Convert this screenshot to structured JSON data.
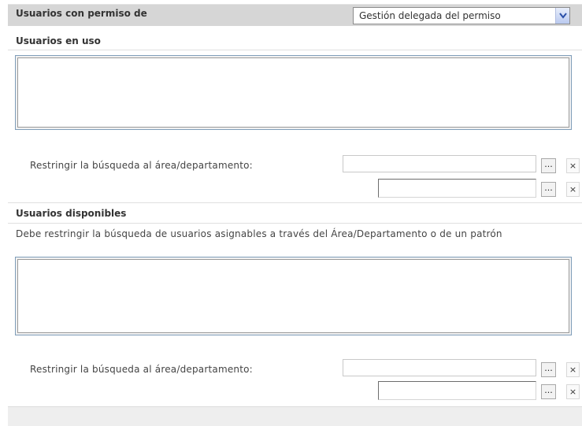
{
  "header": {
    "title": "Usuarios con permiso de",
    "permission_select": {
      "value": "Gestión delegada del permiso",
      "arrow_icon": "chevron-down-icon"
    }
  },
  "in_use": {
    "title": "Usuarios en uso",
    "restrict_label": "Restringir la búsqueda al área/departamento:",
    "browse_label": "...",
    "clear_label": "×"
  },
  "available": {
    "title": "Usuarios disponibles",
    "note": "Debe restringir la búsqueda de usuarios asignables a través del Área/Departamento o de un patrón",
    "restrict_label": "Restringir la búsqueda al área/departamento:",
    "browse_label": "...",
    "clear_label": "×"
  },
  "colors": {
    "header_bg": "#d6d6d6",
    "listbox_border": "#7f9db9",
    "footer_bg": "#eeeeee"
  }
}
